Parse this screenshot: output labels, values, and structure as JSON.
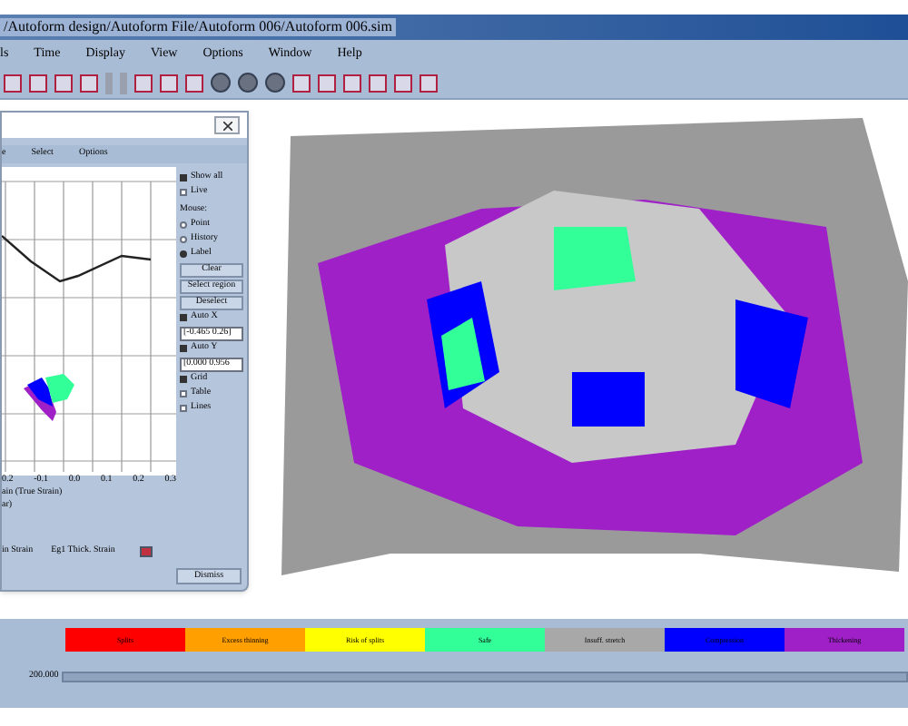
{
  "window": {
    "title": "/Autoform design/Autoform File/Autoform 006/Autoform 006.sim"
  },
  "menu": [
    "ls",
    "Time",
    "Display",
    "View",
    "Options",
    "Window",
    "Help"
  ],
  "dialog": {
    "menu": [
      "e",
      "Select",
      "Options"
    ],
    "x_ticks": [
      "0.2",
      "-0.1",
      "0.0",
      "0.1",
      "0.2",
      "0.3"
    ],
    "axis_title": "ain (True Strain)",
    "axis_unit": "ar)",
    "legend": [
      "in Strain",
      "Eg1 Thick. Strain"
    ],
    "controls": [
      {
        "kind": "check",
        "label": "Show all",
        "checked": true
      },
      {
        "kind": "check",
        "label": "Live",
        "checked": false
      },
      {
        "kind": "heading",
        "label": "Mouse:"
      },
      {
        "kind": "radio",
        "label": "Point",
        "selected": false
      },
      {
        "kind": "radio",
        "label": "History",
        "selected": false
      },
      {
        "kind": "radio",
        "label": "Label",
        "selected": true
      },
      {
        "kind": "button",
        "label": "Clear"
      },
      {
        "kind": "button",
        "label": "Select region"
      },
      {
        "kind": "button",
        "label": "Deselect"
      },
      {
        "kind": "check",
        "label": "Auto X",
        "checked": true
      },
      {
        "kind": "field",
        "value": "[-0.465 0.26]"
      },
      {
        "kind": "check",
        "label": "Auto Y",
        "checked": true
      },
      {
        "kind": "field",
        "value": "[0.000 0.956"
      },
      {
        "kind": "check",
        "label": "Grid",
        "checked": true
      },
      {
        "kind": "check",
        "label": "Table",
        "checked": false
      },
      {
        "kind": "check",
        "label": "Lines",
        "checked": false
      }
    ],
    "dismiss": "Dismiss"
  },
  "legend": [
    {
      "label": "Splits",
      "color": "#ff0000"
    },
    {
      "label": "Excess thinning",
      "color": "#ff9f00"
    },
    {
      "label": "Risk of splits",
      "color": "#ffff00"
    },
    {
      "label": "Safe",
      "color": "#33ff99"
    },
    {
      "label": "Insuff. stretch",
      "color": "#a8a8a8"
    },
    {
      "label": "Compression",
      "color": "#0000ff"
    },
    {
      "label": "Thickening",
      "color": "#a020c8"
    }
  ],
  "time": {
    "value": "200.000",
    "level": 1
  }
}
